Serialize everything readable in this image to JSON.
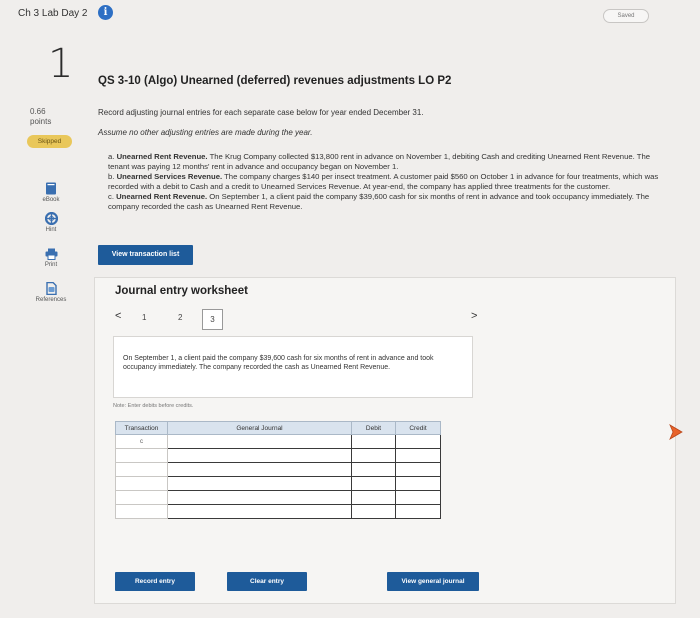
{
  "header": {
    "assignment_title": "Ch 3 Lab Day 2",
    "info_icon": "i",
    "saved_label": "Saved"
  },
  "sidebar": {
    "question_number": "1",
    "points_value": "0.66",
    "points_label": "points",
    "status_badge": "Skipped",
    "tools": [
      {
        "label": "eBook",
        "icon": "book-icon"
      },
      {
        "label": "Hint",
        "icon": "lifebuoy-icon"
      },
      {
        "label": "Print",
        "icon": "printer-icon"
      },
      {
        "label": "References",
        "icon": "document-icon"
      }
    ]
  },
  "question": {
    "title": "QS 3-10 (Algo) Unearned (deferred) revenues adjustments LO P2",
    "instructions": "Record adjusting journal entries for each separate case below for year ended December 31.",
    "assumption": "Assume no other adjusting entries are made during the year.",
    "cases": [
      {
        "letter": "a.",
        "heading": "Unearned Rent Revenue.",
        "text": "The Krug Company collected $13,800 rent in advance on November 1, debiting Cash and crediting Unearned Rent Revenue. The tenant was paying 12 months' rent in advance and occupancy began on November 1."
      },
      {
        "letter": "b.",
        "heading": "Unearned Services Revenue.",
        "text": "The company charges $140 per insect treatment. A customer paid $560 on October 1 in advance for four treatments, which was recorded with a debit to Cash and a credit to Unearned Services Revenue. At year-end, the company has applied three treatments for the customer."
      },
      {
        "letter": "c.",
        "heading": "Unearned Rent Revenue.",
        "text": "On September 1, a client paid the company $39,600 cash for six months of rent in advance and took occupancy immediately. The company recorded the cash as Unearned Rent Revenue."
      }
    ],
    "view_transaction_list_label": "View transaction list"
  },
  "worksheet": {
    "title": "Journal entry worksheet",
    "pages": [
      "1",
      "2",
      "3"
    ],
    "current_page": "3",
    "prev_arrow": "<",
    "next_arrow": ">",
    "description": "On September 1, a client paid the company $39,600 cash for six months of rent in advance and took occupancy immediately. The company recorded the cash as Unearned Rent Revenue.",
    "note": "Note: Enter debits before credits.",
    "table": {
      "headers": [
        "Transaction",
        "General Journal",
        "Debit",
        "Credit"
      ],
      "rows": [
        {
          "transaction": "c",
          "account": "",
          "debit": "",
          "credit": ""
        },
        {
          "transaction": "",
          "account": "",
          "debit": "",
          "credit": ""
        },
        {
          "transaction": "",
          "account": "",
          "debit": "",
          "credit": ""
        },
        {
          "transaction": "",
          "account": "",
          "debit": "",
          "credit": ""
        },
        {
          "transaction": "",
          "account": "",
          "debit": "",
          "credit": ""
        },
        {
          "transaction": "",
          "account": "",
          "debit": "",
          "credit": ""
        }
      ]
    },
    "record_entry_label": "Record entry",
    "clear_entry_label": "Clear entry",
    "view_general_journal_label": "View general journal"
  },
  "colors": {
    "primary_button": "#1e5b9a",
    "info_icon": "#2d6fc4",
    "skipped_badge": "#e9c75a",
    "table_header": "#d9e3ee",
    "cursor": "#e8632b"
  }
}
